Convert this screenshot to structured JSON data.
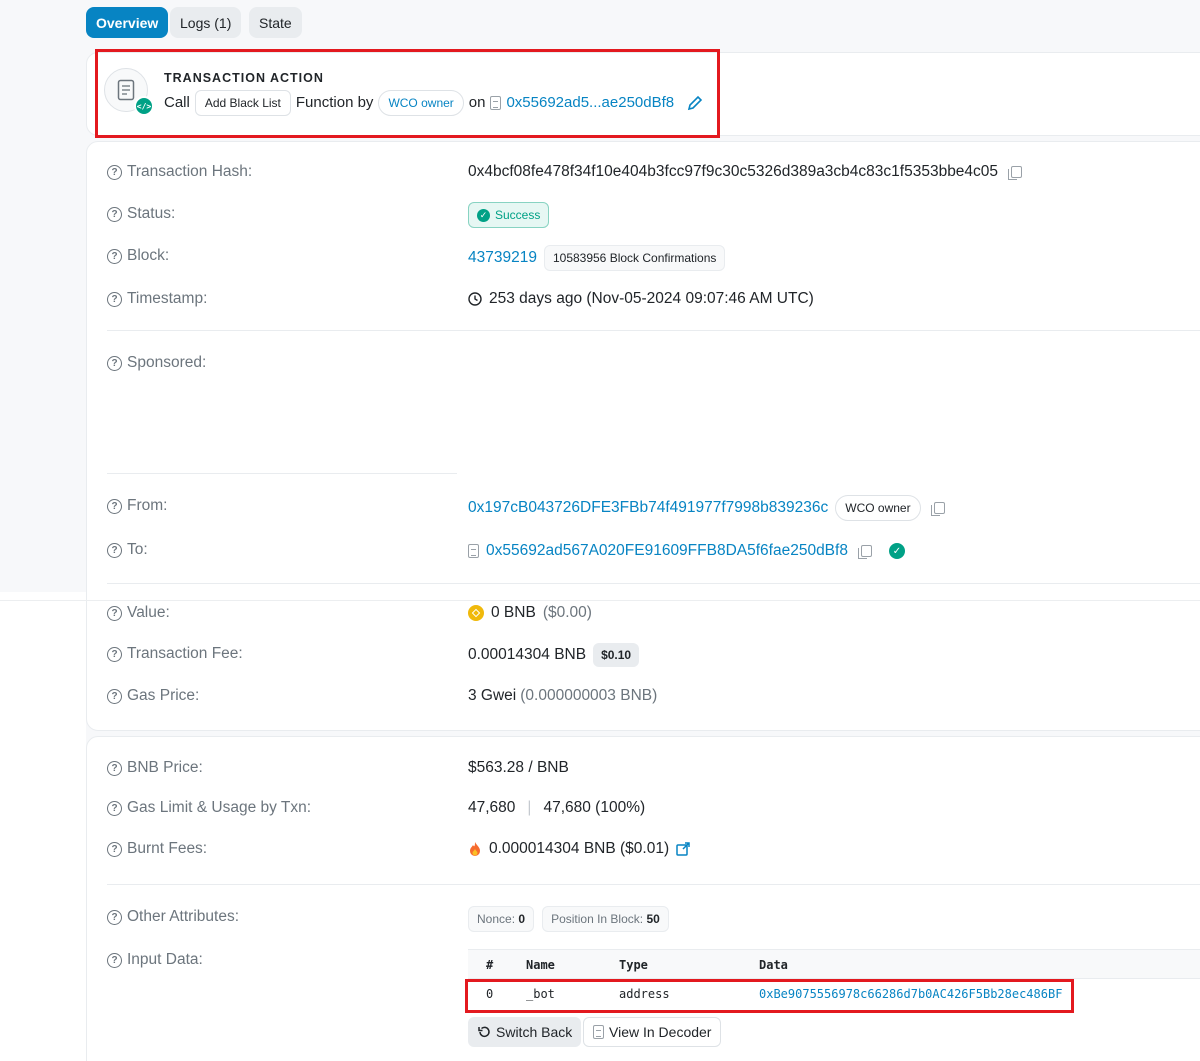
{
  "tabs": [
    "Overview",
    "Logs (1)",
    "State"
  ],
  "action": {
    "title": "TRANSACTION ACTION",
    "call": "Call",
    "method": "Add Black List",
    "function_by": "Function by",
    "by_tag": "WCO owner",
    "on": "on",
    "contract": "0x55692ad5...ae250dBf8"
  },
  "rows": {
    "tx_hash": {
      "label": "Transaction Hash:",
      "value": "0x4bcf08fe478f34f10e404b3fcc97f9c30c5326d389a3cb4c83c1f5353bbe4c05"
    },
    "status": {
      "label": "Status:",
      "value": "Success"
    },
    "block": {
      "label": "Block:",
      "value": "43739219",
      "confirmations": "10583956 Block Confirmations"
    },
    "timestamp": {
      "label": "Timestamp:",
      "value": "253 days ago (Nov-05-2024 09:07:46 AM UTC)"
    },
    "sponsored": {
      "label": "Sponsored:"
    },
    "from": {
      "label": "From:",
      "value": "0x197cB043726DFE3FBb74f491977f7998b839236c",
      "tag": "WCO owner"
    },
    "to": {
      "label": "To:",
      "value": "0x55692ad567A020FE91609FFB8DA5f6fae250dBf8"
    },
    "value": {
      "label": "Value:",
      "amount": "0 BNB",
      "usd": "($0.00)"
    },
    "fee": {
      "label": "Transaction Fee:",
      "amount": "0.00014304 BNB",
      "usd": "$0.10"
    },
    "gas_price": {
      "label": "Gas Price:",
      "amount": "3 Gwei",
      "detail": "(0.000000003 BNB)"
    },
    "bnb_price": {
      "label": "BNB Price:",
      "value": "$563.28 / BNB"
    },
    "gas_limit": {
      "label": "Gas Limit & Usage by Txn:",
      "limit": "47,680",
      "sep": "|",
      "usage": "47,680 (100%)"
    },
    "burnt": {
      "label": "Burnt Fees:",
      "value": "0.000014304 BNB ($0.01)"
    },
    "other": {
      "label": "Other Attributes:",
      "nonce_label": "Nonce:",
      "nonce": "0",
      "pos_label": "Position In Block:",
      "pos": "50"
    },
    "input": {
      "label": "Input Data:"
    }
  },
  "input_table": {
    "headers": [
      "#",
      "Name",
      "Type",
      "Data"
    ],
    "row": [
      "0",
      "_bot",
      "address",
      "0xBe9075556978c66286d7b0AC426F5Bb28ec486BF"
    ]
  },
  "buttons": {
    "switch_back": "Switch Back",
    "view_decoder": "View In Decoder"
  },
  "colors": {
    "accent": "#0784c3",
    "success": "#00a186",
    "highlight": "#e3191f"
  }
}
